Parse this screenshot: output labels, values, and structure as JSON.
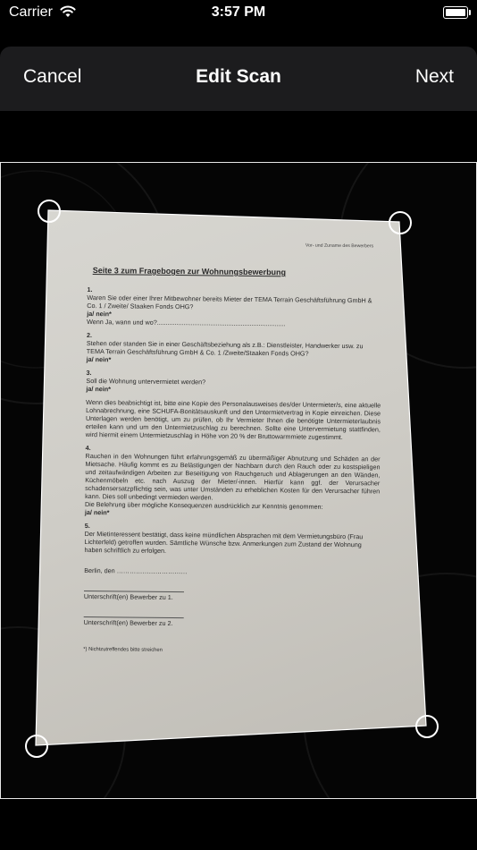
{
  "status_bar": {
    "carrier": "Carrier",
    "time": "3:57 PM"
  },
  "nav": {
    "cancel": "Cancel",
    "title": "Edit Scan",
    "next": "Next"
  },
  "document": {
    "byline": "Vor- und Zuname des Bewerbers",
    "heading": "Seite 3 zum Fragebogen zur Wohnungsbewerbung",
    "q1_num": "1.",
    "q1_text": "Waren Sie oder einer Ihrer Mitbewohner bereits Mieter der TEMA Terrain Geschäftsführung GmbH & Co. 1 / Zweite/ Staaken Fonds OHG?",
    "q1_answer": "ja/ nein*",
    "q1_followup": "Wenn Ja, wann und wo?........................................................................",
    "q2_num": "2.",
    "q2_text": "Stehen oder standen Sie in einer Geschäftsbeziehung als z.B.: Dienstleister, Handwerker usw. zu TEMA Terrain Geschäftsführung GmbH & Co. 1 /Zweite/Staaken Fonds OHG?",
    "q2_answer": "ja/ nein*",
    "q3_num": "3.",
    "q3_text": "Soll die Wohnung untervermietet werden?",
    "q3_answer": "ja/ nein*",
    "q3_note": "Wenn dies beabsichtigt ist, bitte eine Kopie des Personalausweises des/der Untermieter/s, eine aktuelle Lohnabrechnung, eine SCHUFA-Bonitätsauskunft und den Untermietvertrag in Kopie einreichen. Diese Unterlagen werden benötigt, um zu prüfen, ob Ihr Vermieter Ihnen die benötigte Untermieterlaubnis erteilen kann und um den Untermietzuschlag zu berechnen. Sollte eine Untervermietung stattfinden, wird hiermit einem Untermietzuschlag in Höhe von 20 % der Bruttowarmmiete zugestimmt.",
    "q4_num": "4.",
    "q4_text": "Rauchen in den Wohnungen führt erfahrungsgemäß zu übermäßiger Abnutzung und Schäden an der Mietsache. Häufig kommt es zu Belästigungen der Nachbarn durch den Rauch oder zu kostspieligen und zeitaufwändigen Arbeiten zur Beseitigung von Rauchgeruch und Ablagerungen an den Wänden, Küchenmöbeln etc. nach Auszug der Mieter/-innen. Hierfür kann ggf. der Verursacher schadensersatzpflichtig sein, was unter Umständen zu erheblichen Kosten für den Verursacher führen kann. Dies soll unbedingt vermieden werden.",
    "q4_followup": "Die Belehrung über mögliche Konsequenzen ausdrücklich zur Kenntnis genommen:",
    "q4_answer": "ja/ nein*",
    "q5_num": "5.",
    "q5_text": "Der Mietinteressent bestätigt, dass keine mündlichen Absprachen mit dem Vermietungsbüro (Frau Lichterfeld) getroffen wurden. Sämtliche Wünsche bzw. Anmerkungen zum Zustand der Wohnung haben schriftlich zu erfolgen.",
    "place_date": "Berlin, den ……………………………",
    "sig1": "Unterschrift(en) Bewerber zu 1.",
    "sig2": "Unterschrift(en) Bewerber zu 2.",
    "footnote": "*) Nichtzutreffendes bitte streichen"
  }
}
